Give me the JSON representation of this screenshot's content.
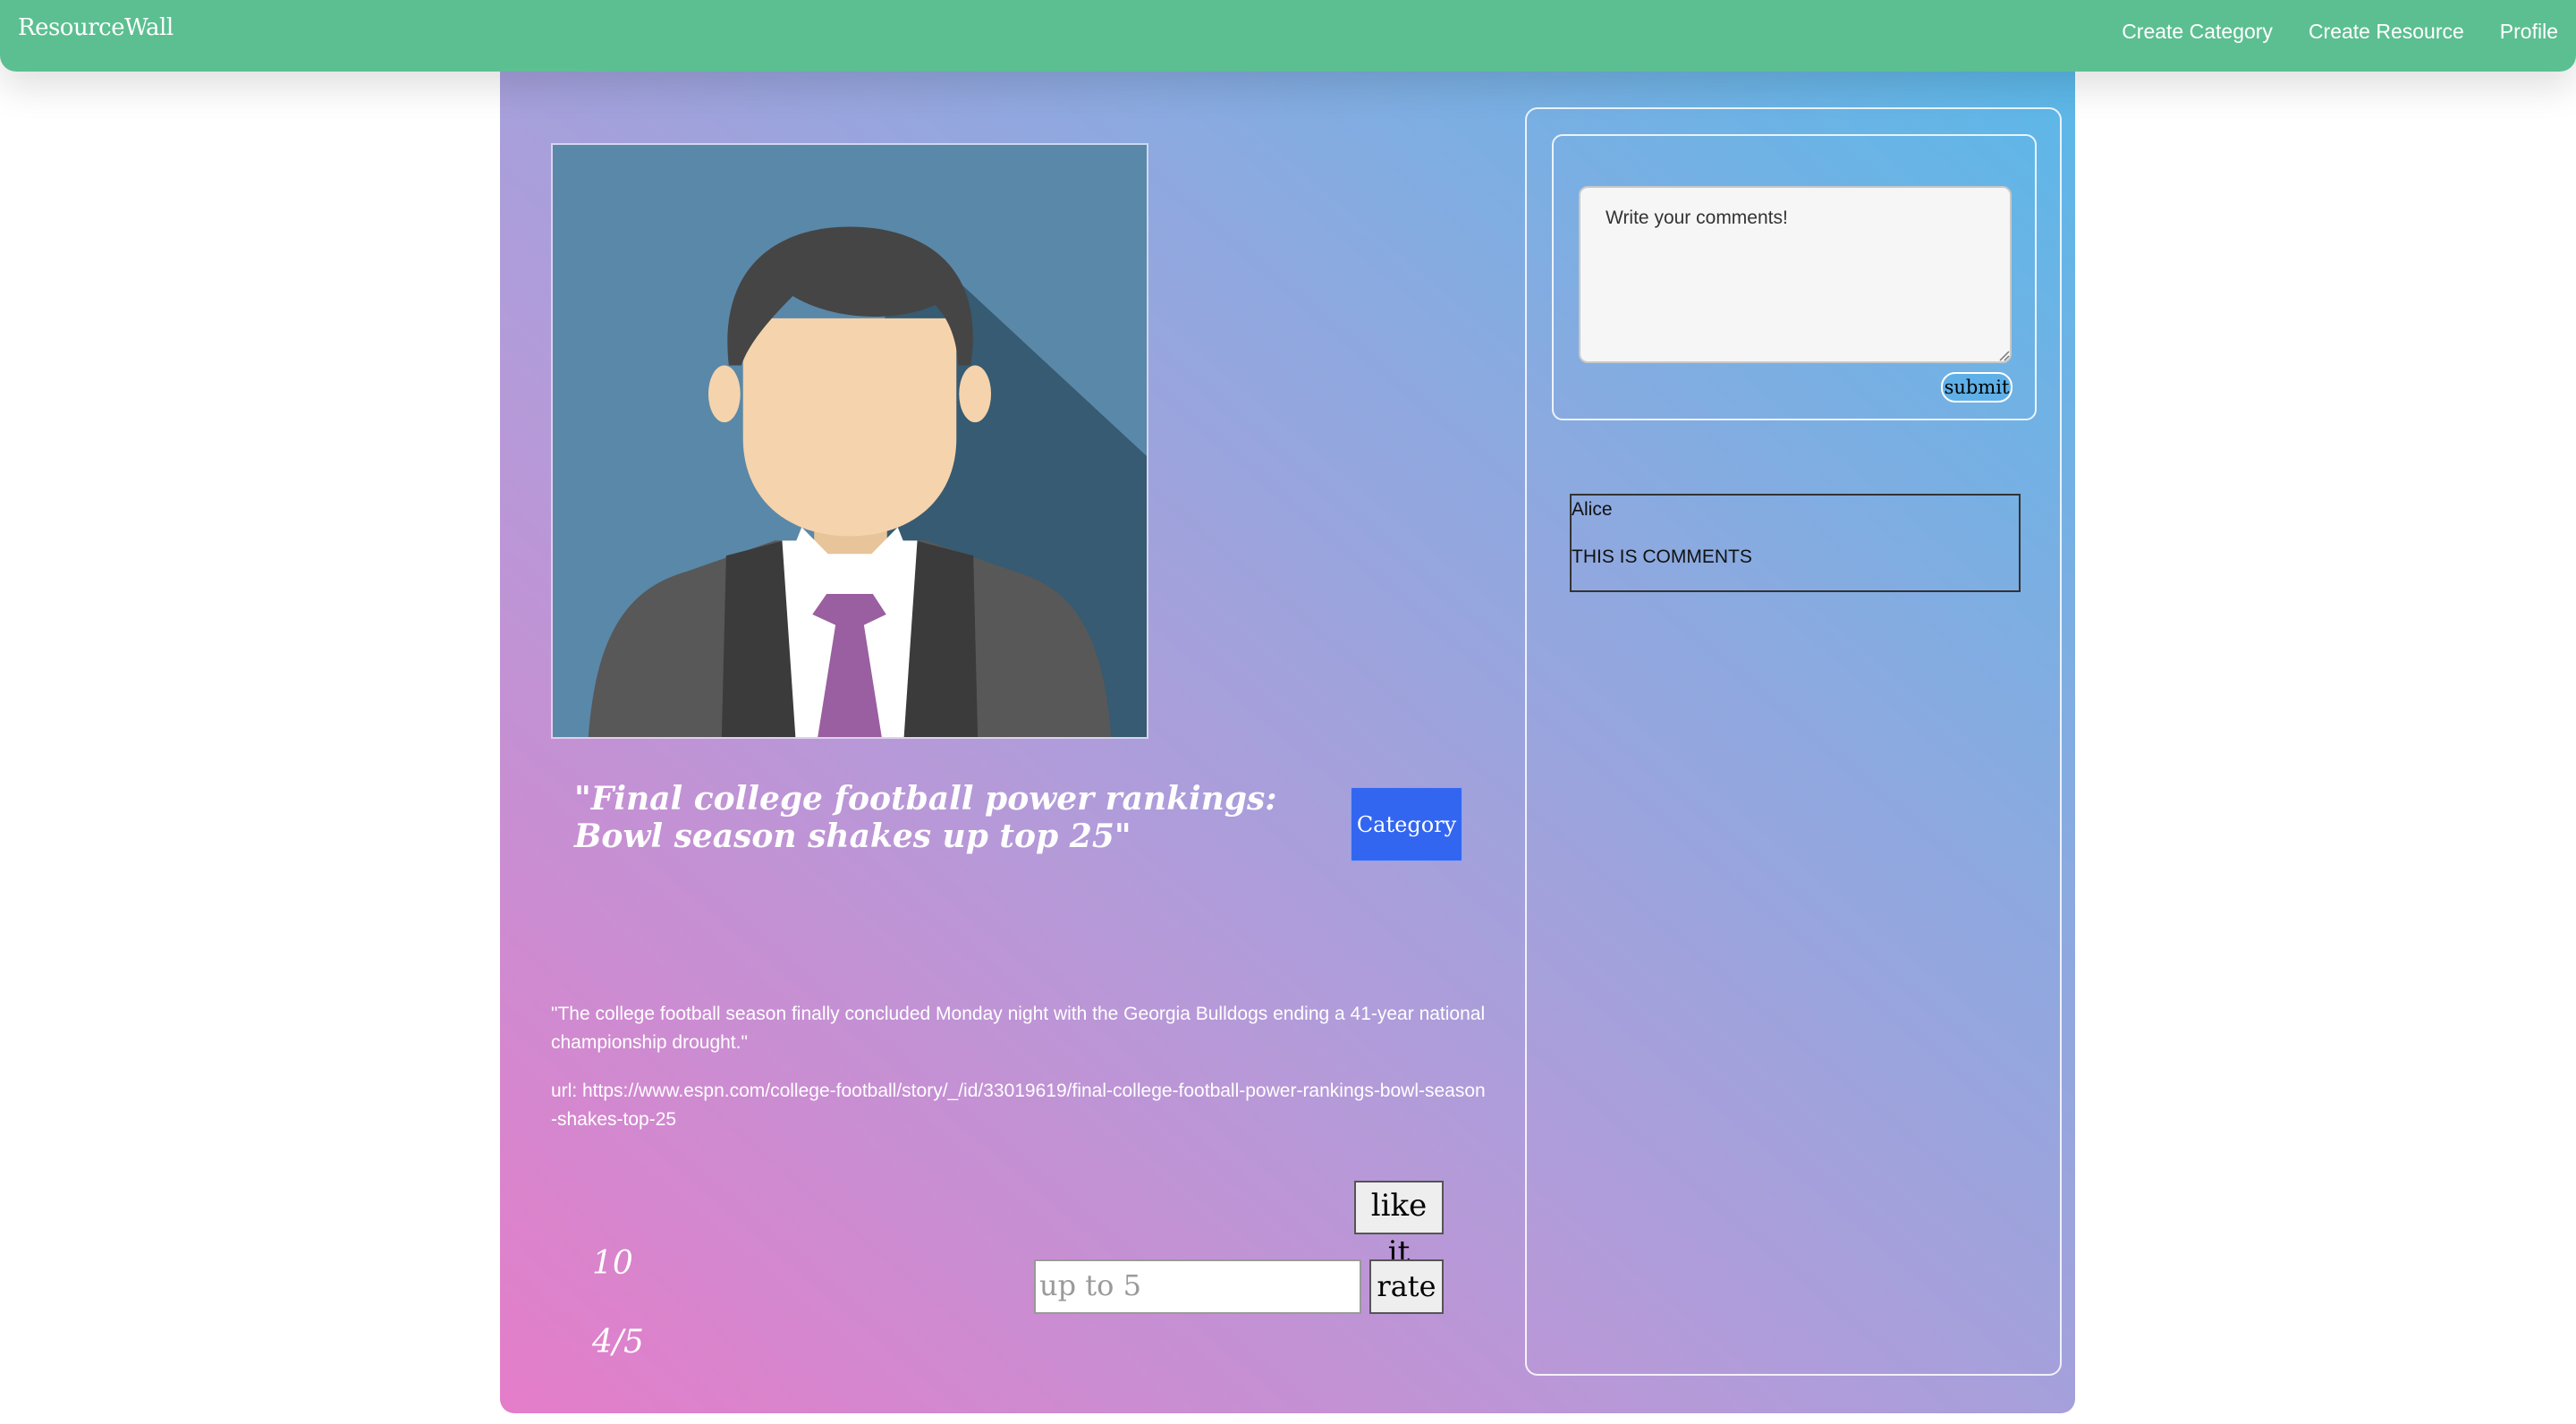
{
  "navbar": {
    "brand": "ResourceWall",
    "links": [
      "Create Category",
      "Create Resource",
      "Profile"
    ]
  },
  "resource": {
    "avatar_icon": "businessman-avatar-icon",
    "title": "\"Final college football power rankings: Bowl season shakes up top 25\"",
    "category_label": "Category",
    "description": "\"The college football season finally concluded Monday night with the Georgia Bulldogs ending a 41-year national championship drought.\"",
    "url_text": "url: https://www.espn.com/college-football/story/_/id/33019619/final-college-football-power-rankings-bowl-season-shakes-top-25",
    "likes": "10",
    "like_label": "like it",
    "rating": "4/5",
    "rate_placeholder": "up to 5",
    "rate_label": "rate"
  },
  "comments": {
    "placeholder": "Write your comments!",
    "submit_label": "submit",
    "items": [
      {
        "author": "Alice",
        "text": "THIS IS COMMENTS"
      }
    ]
  },
  "colors": {
    "navbar": "#5cbf91",
    "category_button": "#3366f0",
    "gradient_start": "#e57dc9",
    "gradient_end": "#5bb8e8"
  }
}
